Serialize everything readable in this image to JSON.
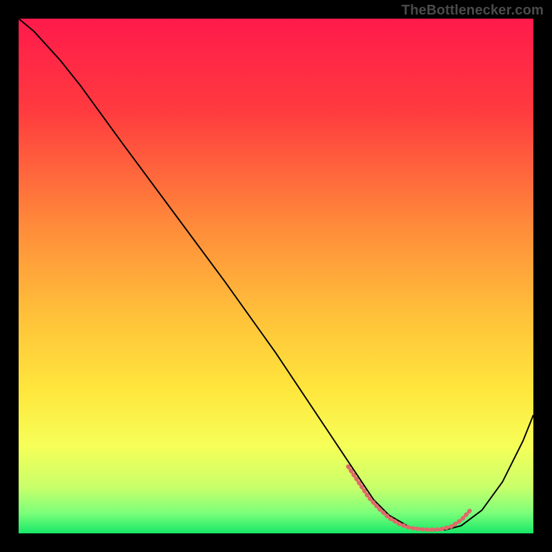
{
  "attribution": "TheBottlenecker.com",
  "chart_data": {
    "type": "line",
    "title": "",
    "xlabel": "",
    "ylabel": "",
    "xlim": [
      0,
      100
    ],
    "ylim": [
      0,
      100
    ],
    "gradient_stops": [
      {
        "offset": 0,
        "color": "#ff1a4b"
      },
      {
        "offset": 18,
        "color": "#ff3b3f"
      },
      {
        "offset": 40,
        "color": "#ff8a3a"
      },
      {
        "offset": 58,
        "color": "#ffc23a"
      },
      {
        "offset": 72,
        "color": "#ffe63c"
      },
      {
        "offset": 83,
        "color": "#f6ff58"
      },
      {
        "offset": 91,
        "color": "#c9ff6a"
      },
      {
        "offset": 96,
        "color": "#7dff7a"
      },
      {
        "offset": 100,
        "color": "#17e868"
      }
    ],
    "series": [
      {
        "name": "bottleneck-curve",
        "color": "#000000",
        "width": 2,
        "x": [
          0,
          3,
          8,
          12,
          20,
          30,
          40,
          50,
          58,
          62,
          66,
          69,
          72,
          76,
          80,
          83,
          86,
          90,
          94,
          98,
          100
        ],
        "y": [
          100,
          97.5,
          92,
          87,
          76,
          62.5,
          49,
          35,
          23,
          17,
          11,
          6.5,
          3.5,
          1.2,
          0.6,
          0.7,
          1.5,
          4.5,
          10,
          18,
          23
        ]
      },
      {
        "name": "optimal-range-marker",
        "color": "#e06a6a",
        "width": 6,
        "dash": "1.5 5.5",
        "linecap": "round",
        "x": [
          64,
          66,
          68,
          70,
          72,
          74,
          76,
          78,
          80,
          82,
          84,
          86,
          88
        ],
        "y": [
          13,
          10,
          7,
          4.8,
          3.0,
          1.8,
          1.1,
          0.8,
          0.7,
          0.8,
          1.3,
          2.6,
          4.8
        ]
      }
    ]
  }
}
